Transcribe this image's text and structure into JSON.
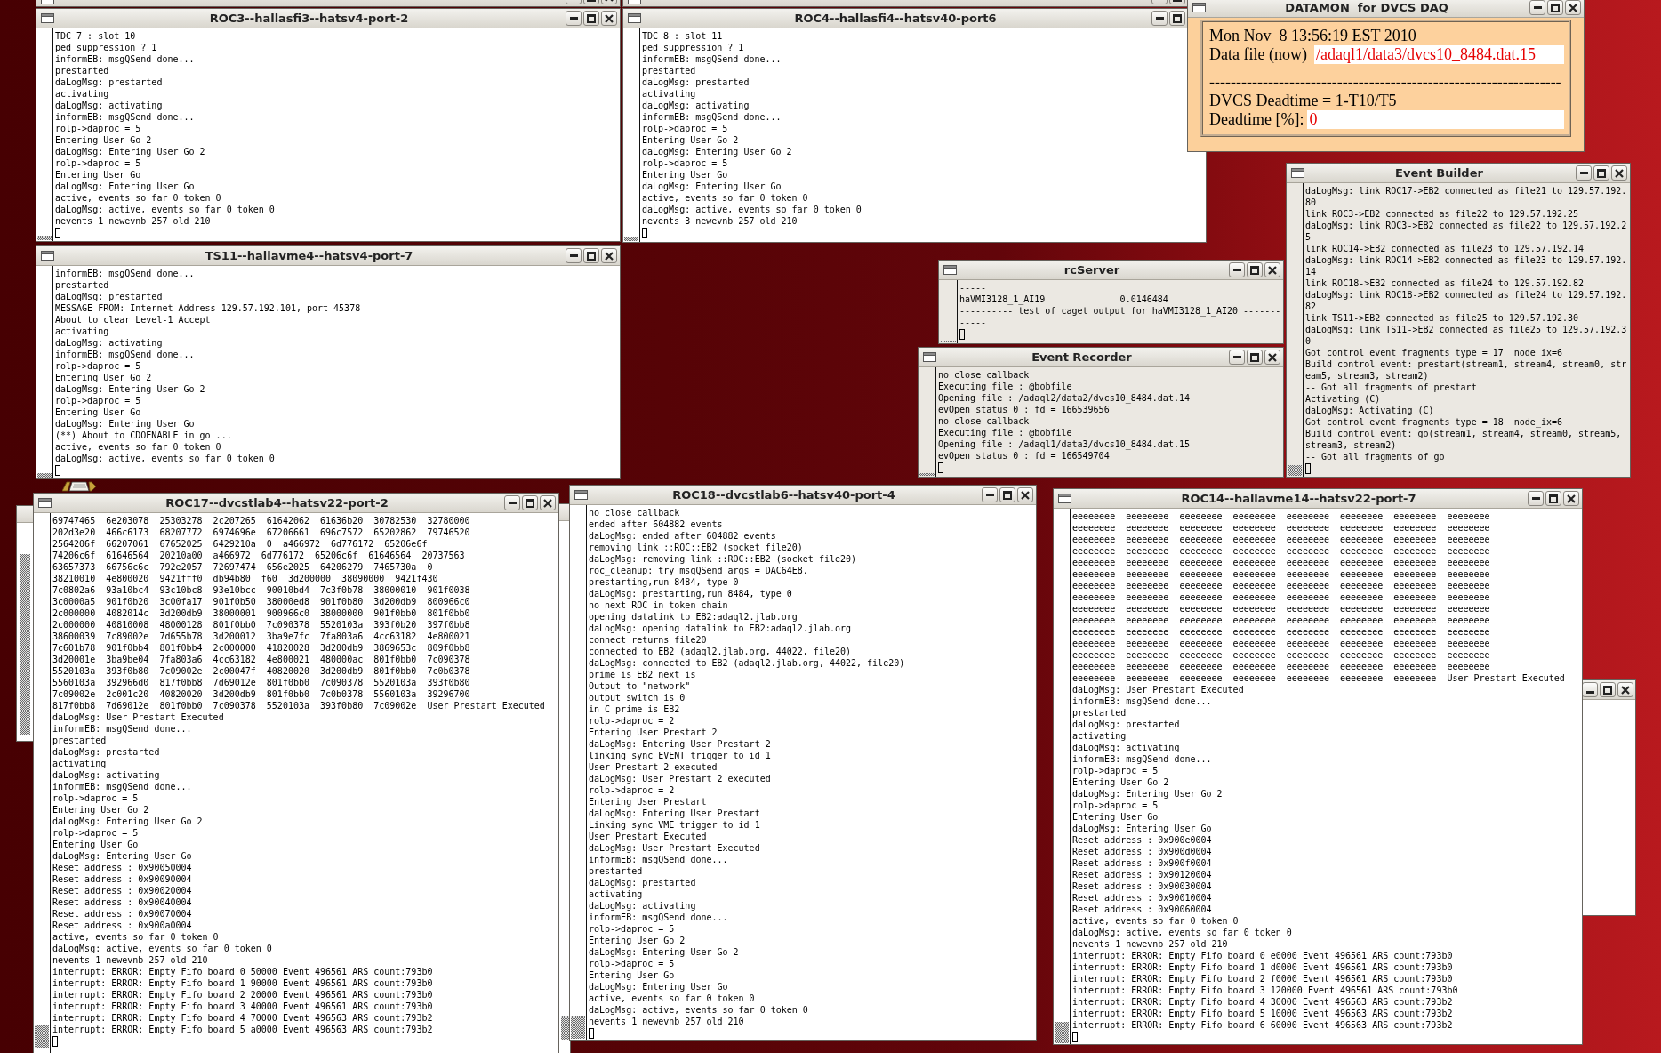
{
  "windows": [
    {
      "kind": "covered"
    },
    {
      "kind": "covered"
    },
    {
      "kind": "terminal",
      "title": "ROC3--hallasfi3--hatsv4-port-2",
      "lines": [
        "TDC 7 : slot 10",
        "ped suppression ? 1",
        "informEB: msgQSend done...",
        "prestarted",
        "daLogMsg: prestarted",
        "activating",
        "daLogMsg: activating",
        "informEB: msgQSend done...",
        "rolp->daproc = 5",
        "Entering User Go 2",
        "daLogMsg: Entering User Go 2",
        "rolp->daproc = 5",
        "Entering User Go",
        "daLogMsg: Entering User Go",
        "active, events so far 0 token 0",
        "daLogMsg: active, events so far 0 token 0",
        "nevents 1 newevnb 257 old 210"
      ]
    },
    {
      "kind": "terminal",
      "title": "ROC4--hallasfi4--hatsv40-port6",
      "lines": [
        "TDC 8 : slot 11",
        "ped suppression ? 1",
        "informEB: msgQSend done...",
        "prestarted",
        "daLogMsg: prestarted",
        "activating",
        "daLogMsg: activating",
        "informEB: msgQSend done...",
        "rolp->daproc = 5",
        "Entering User Go 2",
        "daLogMsg: Entering User Go 2",
        "rolp->daproc = 5",
        "Entering User Go",
        "daLogMsg: Entering User Go",
        "active, events so far 0 token 0",
        "daLogMsg: active, events so far 0 token 0",
        "nevents 3 newevnb 257 old 210"
      ]
    },
    {
      "kind": "monitor",
      "title": "DATAMON  for DVCS DAQ",
      "date": "Mon Nov  8 13:56:19 EST 2010",
      "data_file_label": "Data file (now)",
      "data_file": "/adaql1/data3/dvcs10_8484.dat.15",
      "separator": "------------------------------------------------------------------",
      "formula": "DVCS Deadtime = 1-T10/T5",
      "deadtime_label": "Deadtime [%]:",
      "deadtime": "0"
    },
    {
      "kind": "terminal",
      "title": "TS11--hallavme4--hatsv4-port-7",
      "lines": [
        "informEB: msgQSend done...",
        "prestarted",
        "daLogMsg: prestarted",
        "MESSAGE FROM: Internet Address 129.57.192.101, port 45378",
        "About to clear Level-1 Accept",
        "activating",
        "daLogMsg: activating",
        "informEB: msgQSend done...",
        "rolp->daproc = 5",
        "Entering User Go 2",
        "daLogMsg: Entering User Go 2",
        "rolp->daproc = 5",
        "Entering User Go",
        "daLogMsg: Entering User Go",
        "(**) About to CDOENABLE in go ...",
        "active, events so far 0 token 0",
        "daLogMsg: active, events so far 0 token 0"
      ]
    },
    {
      "kind": "console",
      "title": "rcServer",
      "lines": [
        "-----",
        "haVMI3128_1_AI19              0.0146484",
        "---------- test of caget output for haVMI3128_1_AI20 -------",
        "-----"
      ]
    },
    {
      "kind": "console",
      "title": "Event Recorder",
      "lines": [
        "no close callback",
        "Executing file : @bobfile",
        "Opening file : /adaql2/data2/dvcs10_8484.dat.14",
        "evOpen status 0 : fd = 166539656",
        "no close callback",
        "Executing file : @bobfile",
        "Opening file : /adaql1/data3/dvcs10_8484.dat.15",
        "evOpen status 0 : fd = 166549704"
      ]
    },
    {
      "kind": "console",
      "title": "Event Builder",
      "lines": [
        "daLogMsg: link ROC17->EB2 connected as file21 to 129.57.192.",
        "80",
        "link ROC3->EB2 connected as file22 to 129.57.192.25",
        "daLogMsg: link ROC3->EB2 connected as file22 to 129.57.192.2",
        "5",
        "link ROC14->EB2 connected as file23 to 129.57.192.14",
        "daLogMsg: link ROC14->EB2 connected as file23 to 129.57.192.",
        "14",
        "link ROC18->EB2 connected as file24 to 129.57.192.82",
        "daLogMsg: link ROC18->EB2 connected as file24 to 129.57.192.",
        "82",
        "link TS11->EB2 connected as file25 to 129.57.192.30",
        "daLogMsg: link TS11->EB2 connected as file25 to 129.57.192.3",
        "0",
        "Got control event fragments type = 17  node_ix=6",
        "Build control event: prestart(stream1, stream4, stream0, str",
        "eam5, stream3, stream2)",
        "-- Got all fragments of prestart",
        "Activating (C)",
        "daLogMsg: Activating (C)",
        "Got control event fragments type = 18  node_ix=6",
        "Build control event: go(stream1, stream4, stream0, stream5,",
        "stream3, stream2)",
        "-- Got all fragments of go"
      ]
    },
    {
      "kind": "terminal",
      "title": "ROC17--dvcstlab4--hatsv22-port-2",
      "lines": [
        "69747465  6e203078  25303278  2c207265  61642062  61636b20  30782530  32780000",
        "202d3e20  466c6173  68207772  6974696e  67206661  696c7572  65202862  79746520",
        "2564206f  66207061  67652025  6429210a  0  a466972  6d776172  65206e6f",
        "74206c6f  61646564  20210a00  a466972  6d776172  65206c6f  61646564  20737563",
        "63657373  66756c6c  792e2057  72697474  656e2025  64206279  7465730a  0",
        "38210010  4e800020  9421fff0  db94b80  f60  3d200000  38090000  9421f430",
        "7c0802a6  93a10bc4  93c10bc8  93e10bcc  90010bd4  7c3f0b78  38000010  901f0038",
        "3c0000a5  901f0b20  3c00fa17  901f0b50  38000ed8  901f0b80  3d200db9  800966c0",
        "2c000000  4082014c  3d200db9  38000001  900966c0  38000000  901f0bb0  801f0bb0",
        "2c000000  40810008  48000128  801f0bb0  7c090378  5520103a  393f0b20  397f0bb8",
        "38600039  7c89002e  7d655b78  3d200012  3ba9e7fc  7fa803a6  4cc63182  4e800021",
        "7c601b78  901f0bb4  801f0bb4  2c000000  41820028  3d200db9  3869653c  809f0bb8",
        "3d20001e  3ba9be04  7fa803a6  4cc63182  4e800021  480000ac  801f0bb0  7c090378",
        "5520103a  393f0b80  7c09002e  2c00047f  40820020  3d200db9  801f0bb0  7c0b0378",
        "5560103a  392966d0  817f0bb8  7d69012e  801f0bb0  7c090378  5520103a  393f0b80",
        "7c09002e  2c001c20  40820020  3d200db9  801f0bb0  7c0b0378  5560103a  39296700",
        "817f0bb8  7d69012e  801f0bb0  7c090378  5520103a  393f0b80  7c09002e  User Prestart Executed",
        "daLogMsg: User Prestart Executed",
        "informEB: msgQSend done...",
        "prestarted",
        "daLogMsg: prestarted",
        "activating",
        "daLogMsg: activating",
        "informEB: msgQSend done...",
        "rolp->daproc = 5",
        "Entering User Go 2",
        "daLogMsg: Entering User Go 2",
        "rolp->daproc = 5",
        "Entering User Go",
        "daLogMsg: Entering User Go",
        "Reset address : 0x90050004",
        "Reset address : 0x90090004",
        "Reset address : 0x90020004",
        "Reset address : 0x90040004",
        "Reset address : 0x90070004",
        "Reset address : 0x900a0004",
        "active, events so far 0 token 0",
        "daLogMsg: active, events so far 0 token 0",
        "nevents 1 newevnb 257 old 210",
        "interrupt: ERROR: Empty Fifo board 0 50000 Event 496561 ARS count:793b0",
        "interrupt: ERROR: Empty Fifo board 1 90000 Event 496561 ARS count:793b0",
        "interrupt: ERROR: Empty Fifo board 2 20000 Event 496561 ARS count:793b0",
        "interrupt: ERROR: Empty Fifo board 3 40000 Event 496561 ARS count:793b0",
        "interrupt: ERROR: Empty Fifo board 4 70000 Event 496563 ARS count:793b2",
        "interrupt: ERROR: Empty Fifo board 5 a0000 Event 496563 ARS count:793b2"
      ]
    },
    {
      "kind": "terminal",
      "title": "ROC18--dvcstlab6--hatsv40-port-4",
      "lines": [
        "no close callback",
        "ended after 604882 events",
        "daLogMsg: ended after 604882 events",
        "removing link ::ROC::EB2 (socket file20)",
        "daLogMsg: removing link ::ROC::EB2 (socket file20)",
        "roc_cleanup: try msgQSend args = DAC64E8.",
        "prestarting,run 8484, type 0",
        "daLogMsg: prestarting,run 8484, type 0",
        "no next ROC in token chain",
        "opening datalink to EB2:adaql2.jlab.org",
        "daLogMsg: opening datalink to EB2:adaql2.jlab.org",
        "connect returns file20",
        "connected to EB2 (adaql2.jlab.org, 44022, file20)",
        "daLogMsg: connected to EB2 (adaql2.jlab.org, 44022, file20)",
        "prime is EB2 next is",
        "Output to \"network\"",
        "output switch is 0",
        "in C prime is EB2",
        "rolp->daproc = 2",
        "Entering User Prestart 2",
        "daLogMsg: Entering User Prestart 2",
        "linking sync EVENT trigger to id 1",
        "User Prestart 2 executed",
        "daLogMsg: User Prestart 2 executed",
        "rolp->daproc = 2",
        "Entering User Prestart",
        "daLogMsg: Entering User Prestart",
        "Linking sync VME trigger to id 1",
        "User Prestart Executed",
        "daLogMsg: User Prestart Executed",
        "informEB: msgQSend done...",
        "prestarted",
        "daLogMsg: prestarted",
        "activating",
        "daLogMsg: activating",
        "informEB: msgQSend done...",
        "rolp->daproc = 5",
        "Entering User Go 2",
        "daLogMsg: Entering User Go 2",
        "rolp->daproc = 5",
        "Entering User Go",
        "daLogMsg: Entering User Go",
        "active, events so far 0 token 0",
        "daLogMsg: active, events so far 0 token 0",
        "nevents 1 newevnb 257 old 210"
      ]
    },
    {
      "kind": "terminal",
      "title": "ROC14--hallavme14--hatsv22-port-7",
      "lines": [
        "eeeeeeee  eeeeeeee  eeeeeeee  eeeeeeee  eeeeeeee  eeeeeeee  eeeeeeee  eeeeeeee",
        "eeeeeeee  eeeeeeee  eeeeeeee  eeeeeeee  eeeeeeee  eeeeeeee  eeeeeeee  eeeeeeee",
        "eeeeeeee  eeeeeeee  eeeeeeee  eeeeeeee  eeeeeeee  eeeeeeee  eeeeeeee  eeeeeeee",
        "eeeeeeee  eeeeeeee  eeeeeeee  eeeeeeee  eeeeeeee  eeeeeeee  eeeeeeee  eeeeeeee",
        "eeeeeeee  eeeeeeee  eeeeeeee  eeeeeeee  eeeeeeee  eeeeeeee  eeeeeeee  eeeeeeee",
        "eeeeeeee  eeeeeeee  eeeeeeee  eeeeeeee  eeeeeeee  eeeeeeee  eeeeeeee  eeeeeeee",
        "eeeeeeee  eeeeeeee  eeeeeeee  eeeeeeee  eeeeeeee  eeeeeeee  eeeeeeee  eeeeeeee",
        "eeeeeeee  eeeeeeee  eeeeeeee  eeeeeeee  eeeeeeee  eeeeeeee  eeeeeeee  eeeeeeee",
        "eeeeeeee  eeeeeeee  eeeeeeee  eeeeeeee  eeeeeeee  eeeeeeee  eeeeeeee  eeeeeeee",
        "eeeeeeee  eeeeeeee  eeeeeeee  eeeeeeee  eeeeeeee  eeeeeeee  eeeeeeee  eeeeeeee",
        "eeeeeeee  eeeeeeee  eeeeeeee  eeeeeeee  eeeeeeee  eeeeeeee  eeeeeeee  eeeeeeee",
        "eeeeeeee  eeeeeeee  eeeeeeee  eeeeeeee  eeeeeeee  eeeeeeee  eeeeeeee  eeeeeeee",
        "eeeeeeee  eeeeeeee  eeeeeeee  eeeeeeee  eeeeeeee  eeeeeeee  eeeeeeee  eeeeeeee",
        "eeeeeeee  eeeeeeee  eeeeeeee  eeeeeeee  eeeeeeee  eeeeeeee  eeeeeeee  eeeeeeee",
        "eeeeeeee  eeeeeeee  eeeeeeee  eeeeeeee  eeeeeeee  eeeeeeee  eeeeeeee  User Prestart Executed",
        "daLogMsg: User Prestart Executed",
        "informEB: msgQSend done...",
        "prestarted",
        "daLogMsg: prestarted",
        "activating",
        "daLogMsg: activating",
        "informEB: msgQSend done...",
        "rolp->daproc = 5",
        "Entering User Go 2",
        "daLogMsg: Entering User Go 2",
        "rolp->daproc = 5",
        "Entering User Go",
        "daLogMsg: Entering User Go",
        "Reset address : 0x900e0004",
        "Reset address : 0x900d0004",
        "Reset address : 0x900f0004",
        "Reset address : 0x90120004",
        "Reset address : 0x90030004",
        "Reset address : 0x90010004",
        "Reset address : 0x90060004",
        "active, events so far 0 token 0",
        "daLogMsg: active, events so far 0 token 0",
        "nevents 1 newevnb 257 old 210",
        "interrupt: ERROR: Empty Fifo board 0 e0000 Event 496561 ARS count:793b0",
        "interrupt: ERROR: Empty Fifo board 1 d0000 Event 496561 ARS count:793b0",
        "interrupt: ERROR: Empty Fifo board 2 f0000 Event 496561 ARS count:793b0",
        "interrupt: ERROR: Empty Fifo board 3 120000 Event 496561 ARS count:793b0",
        "interrupt: ERROR: Empty Fifo board 4 30000 Event 496563 ARS count:793b2",
        "interrupt: ERROR: Empty Fifo board 5 10000 Event 496563 ARS count:793b2",
        "interrupt: ERROR: Empty Fifo board 6 60000 Event 496563 ARS count:793b2"
      ]
    }
  ]
}
